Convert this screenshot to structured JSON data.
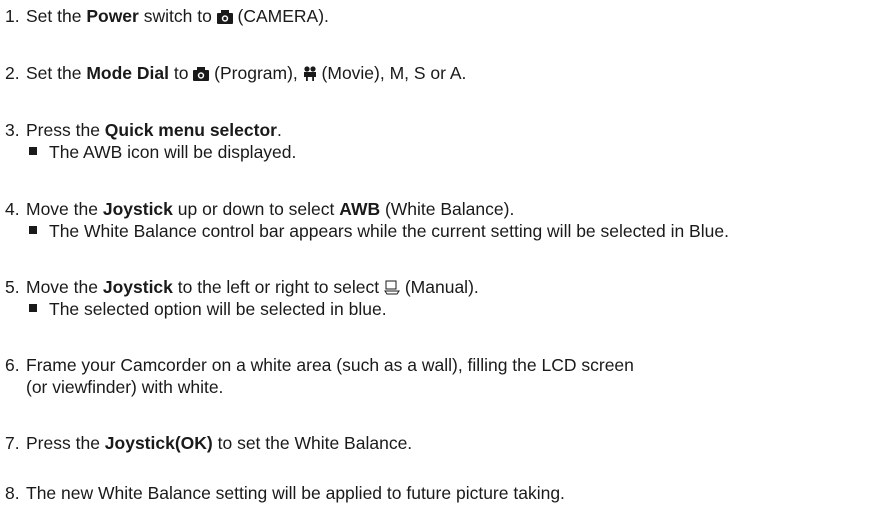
{
  "steps": [
    {
      "num": "1.",
      "t1": "Set the ",
      "b1": "Power",
      "t2": " switch to ",
      "t3": " (CAMERA)."
    },
    {
      "num": "2.",
      "t1": "Set the ",
      "b1": "Mode Dial",
      "t2": " to ",
      "t3": " (Program), ",
      "t4": " (Movie), M, S or A."
    },
    {
      "num": "3.",
      "t1": "Press the ",
      "b1": "Quick menu selector",
      "t2": ".",
      "sub": "The AWB icon will be displayed."
    },
    {
      "num": "4.",
      "t1": "Move the ",
      "b1": "Joystick",
      "t2": " up or down to select ",
      "b2": "AWB",
      "t3": " (White Balance).",
      "sub": "The White Balance control bar appears while the current setting will be selected in Blue."
    },
    {
      "num": "5.",
      "t1": "Move the ",
      "b1": "Joystick",
      "t2": " to the left or right to select ",
      "t3": " (Manual).",
      "sub": "The selected option will be selected in blue."
    },
    {
      "num": "6.",
      "t1": "Frame your Camcorder on a white area (such as a wall), filling the LCD screen",
      "line2": "(or viewfinder) with white."
    },
    {
      "num": "7.",
      "t1": "Press the ",
      "b1": "Joystick(OK)",
      "t2": " to set the White Balance."
    },
    {
      "num": "8.",
      "t1": "The new White Balance setting will be applied to future picture taking."
    }
  ]
}
